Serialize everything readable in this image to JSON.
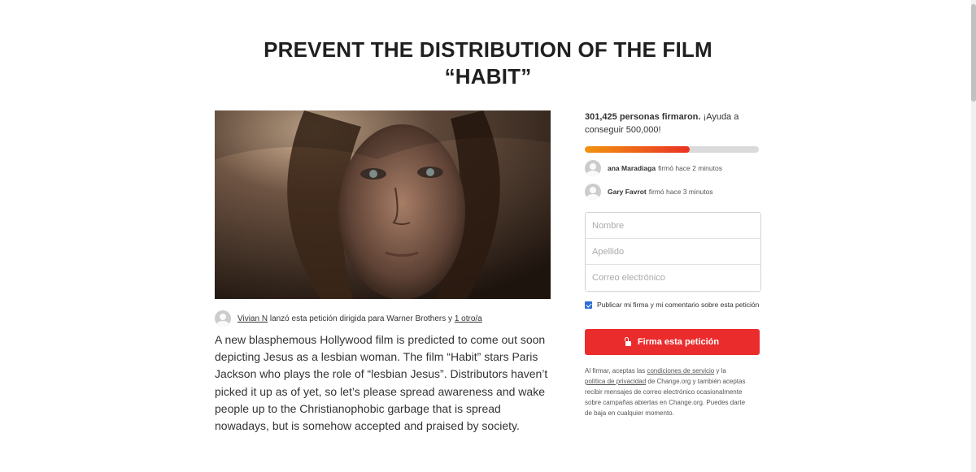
{
  "petition": {
    "title_line1": "PREVENT THE DISTRIBUTION OF THE FILM",
    "title_line2": "“HABIT”",
    "starter": {
      "name": "Vivian N",
      "text": " lanzó esta petición dirigida para Warner Brothers y ",
      "others_link": "1 otro/a"
    },
    "description": "A new blasphemous Hollywood film is predicted to come out soon depicting Jesus as a lesbian woman. The film “Habit” stars Paris Jackson who plays the role of “lesbian Jesus”. Distributors haven’t picked it up as of yet, so let’s please spread awareness and wake people up to the Christianophobic garbage that is spread nowadays, but is somehow accepted and praised by society."
  },
  "sidebar": {
    "count_bold": "301,425 personas firmaron.",
    "count_rest": " ¡Ayuda a conseguir 500,000!",
    "progress_fraction": 0.6029,
    "progress_colors": {
      "start": "#f1940f",
      "end": "#ea3224"
    },
    "recent_signers": [
      {
        "name": "ana Maradiaga",
        "action": "firmó hace 2 minutos"
      },
      {
        "name": "Gary Favrot",
        "action": "firmó hace 3 minutos"
      }
    ],
    "form": {
      "first_name_placeholder": "Nombre",
      "last_name_placeholder": "Apellido",
      "email_placeholder": "Correo electrónico"
    },
    "publish_checkbox_label": "Publicar mi firma y mi comentario sobre esta petición",
    "sign_button_label": "Firma esta petición",
    "legal": {
      "part1": "Al firmar, aceptas las ",
      "terms_link": "condiciones de servicio",
      "part2": " y la ",
      "privacy_link": "política de privacidad",
      "part3": " de Change.org y también aceptas recibir mensajes de correo electrónico ocasionalmente sobre campañas abiertas en Change.org. Puedes darte de baja en cualquier momento."
    }
  },
  "colors": {
    "accent_red": "#ea2c2c",
    "checkbox_blue": "#2b6fd6",
    "title_text": "#1f1f1f"
  }
}
